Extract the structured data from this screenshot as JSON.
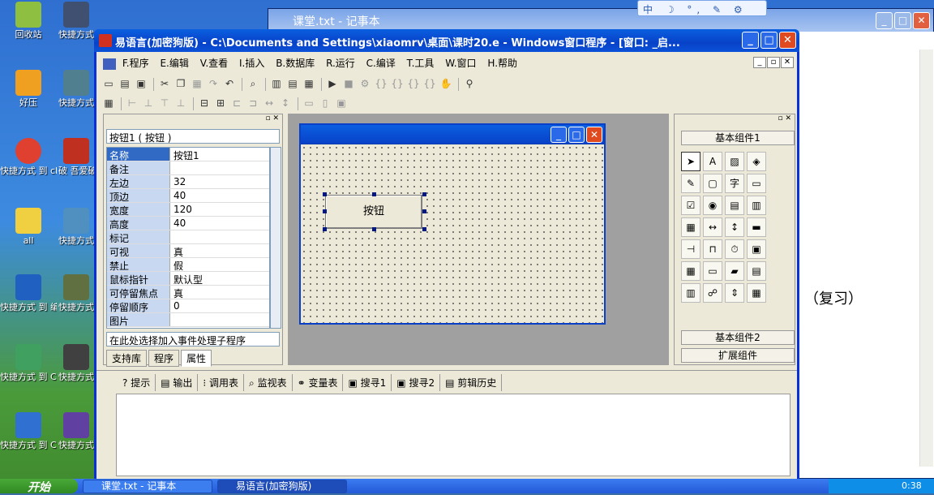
{
  "desktop": {
    "icons": [
      {
        "label": "回收站",
        "color": "#8fbf40"
      },
      {
        "label": "好压",
        "color": "#f0a020"
      },
      {
        "label": "快捷方式 到 chrome",
        "color": "#e04030"
      },
      {
        "label": "all",
        "color": "#f0d040"
      },
      {
        "label": "快捷方式 到 编程助手",
        "color": "#2060c0"
      },
      {
        "label": "快捷方式 到 Ciku",
        "color": "#40a060"
      },
      {
        "label": "快捷方式 到 CometAssi...",
        "color": "#3070d0"
      },
      {
        "label": "快捷方式 Edb",
        "color": "#405070"
      },
      {
        "label": "快捷方式 WebBro",
        "color": "#508090"
      },
      {
        "label": "破 吾爱破",
        "color": "#c03020"
      },
      {
        "label": "快捷方式 View",
        "color": "#5090c0"
      },
      {
        "label": "快捷方式 Cheat E",
        "color": "#607040"
      },
      {
        "label": "快捷方式 JS-",
        "color": "#404040"
      },
      {
        "label": "快捷方式 鬼鬼JS",
        "color": "#6040a0"
      }
    ]
  },
  "notepad": {
    "title": "课堂.txt - 记事本",
    "text": "（复习）"
  },
  "ime": {
    "text": "中 ☽ °, ✎ ⚙"
  },
  "window": {
    "title": "易语言(加密狗版) - C:\\Documents and Settings\\xiaomrv\\桌面\\课时20.e - Windows窗口程序 - [窗口: _启...",
    "buttons": {
      "min": "_",
      "max": "□",
      "close": "✕"
    }
  },
  "menu": [
    {
      "label": "F.程序"
    },
    {
      "label": "E.编辑"
    },
    {
      "label": "V.查看"
    },
    {
      "label": "I.插入"
    },
    {
      "label": "B.数据库"
    },
    {
      "label": "R.运行"
    },
    {
      "label": "C.编译"
    },
    {
      "label": "T.工具"
    },
    {
      "label": "W.窗口"
    },
    {
      "label": "H.帮助"
    }
  ],
  "properties": {
    "selected_object": "按钮1 ( 按钮 )",
    "rows": [
      {
        "name": "名称",
        "value": "按钮1"
      },
      {
        "name": "备注",
        "value": ""
      },
      {
        "name": "左边",
        "value": "32"
      },
      {
        "name": "顶边",
        "value": "40"
      },
      {
        "name": "宽度",
        "value": "120"
      },
      {
        "name": "高度",
        "value": "40"
      },
      {
        "name": "标记",
        "value": ""
      },
      {
        "name": "可视",
        "value": "真"
      },
      {
        "name": "禁止",
        "value": "假"
      },
      {
        "name": "鼠标指针",
        "value": "默认型"
      },
      {
        "name": "可停留焦点",
        "value": "真"
      },
      {
        "name": "  停留顺序",
        "value": "0"
      },
      {
        "name": "图片",
        "value": ""
      }
    ],
    "event_select": "在此处选择加入事件处理子程序",
    "tabs": {
      "support": "支持库",
      "program": "程序",
      "property": "属性"
    }
  },
  "form": {
    "button_label": "按钮"
  },
  "components": {
    "basic": "基本组件1",
    "basic2": "基本组件2",
    "extended": "扩展组件"
  },
  "bottom": {
    "tabs": [
      {
        "label": "提示"
      },
      {
        "label": "输出"
      },
      {
        "label": "调用表"
      },
      {
        "label": "监视表"
      },
      {
        "label": "变量表"
      },
      {
        "label": "搜寻1"
      },
      {
        "label": "搜寻2"
      },
      {
        "label": "剪辑历史"
      }
    ]
  },
  "taskbar": {
    "start": "开始",
    "tasks": [
      {
        "label": "课堂.txt - 记事本"
      },
      {
        "label": "易语言(加密狗版)"
      }
    ],
    "clock": "0:38"
  }
}
